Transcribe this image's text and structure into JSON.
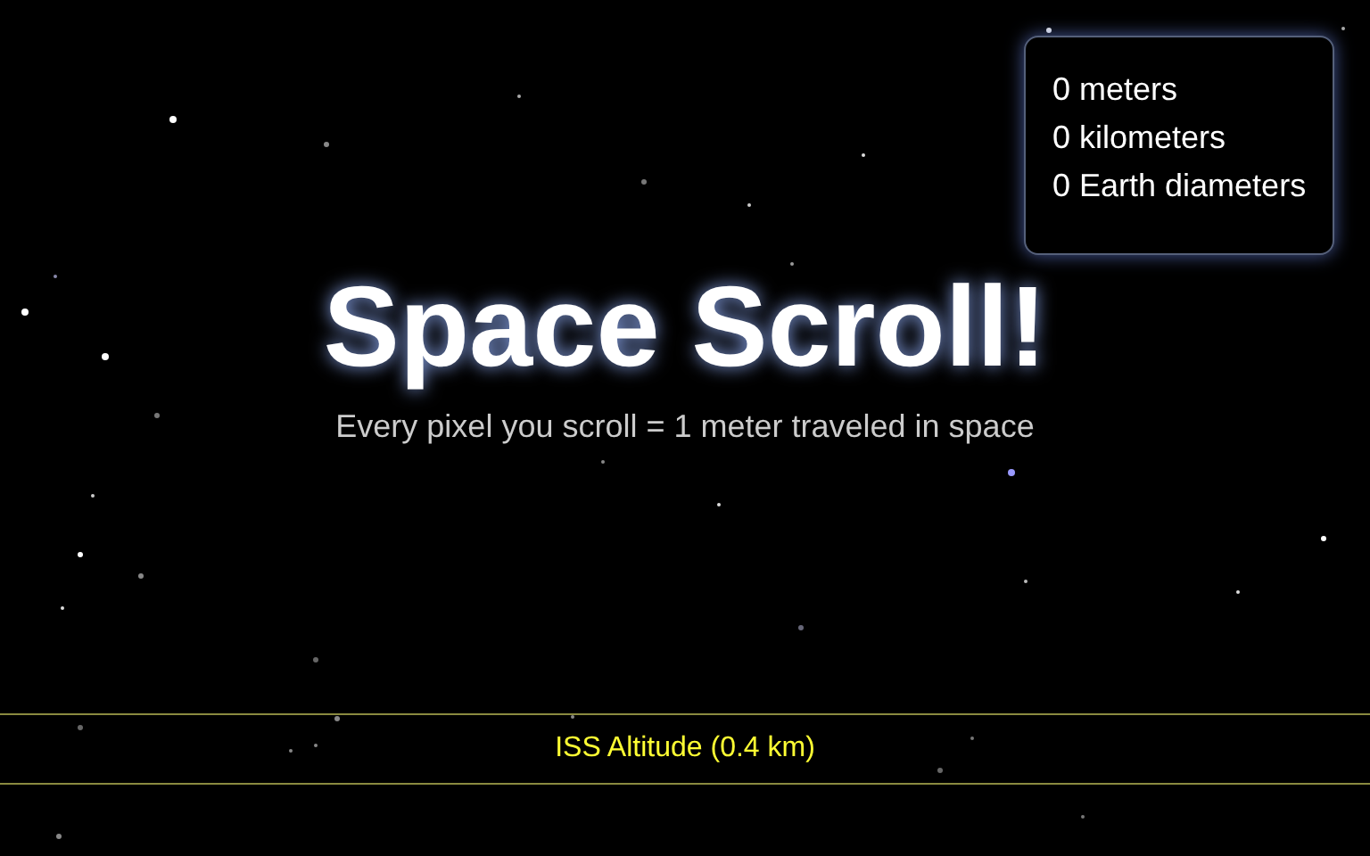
{
  "distance_panel": {
    "lines": [
      "0 meters",
      "0 kilometers",
      "0 Earth diameters"
    ]
  },
  "hero": {
    "title": "Space Scroll!",
    "subtitle": "Every pixel you scroll = 1 meter traveled in space"
  },
  "markers": [
    {
      "label": "ISS Altitude (0.4 km)"
    }
  ]
}
